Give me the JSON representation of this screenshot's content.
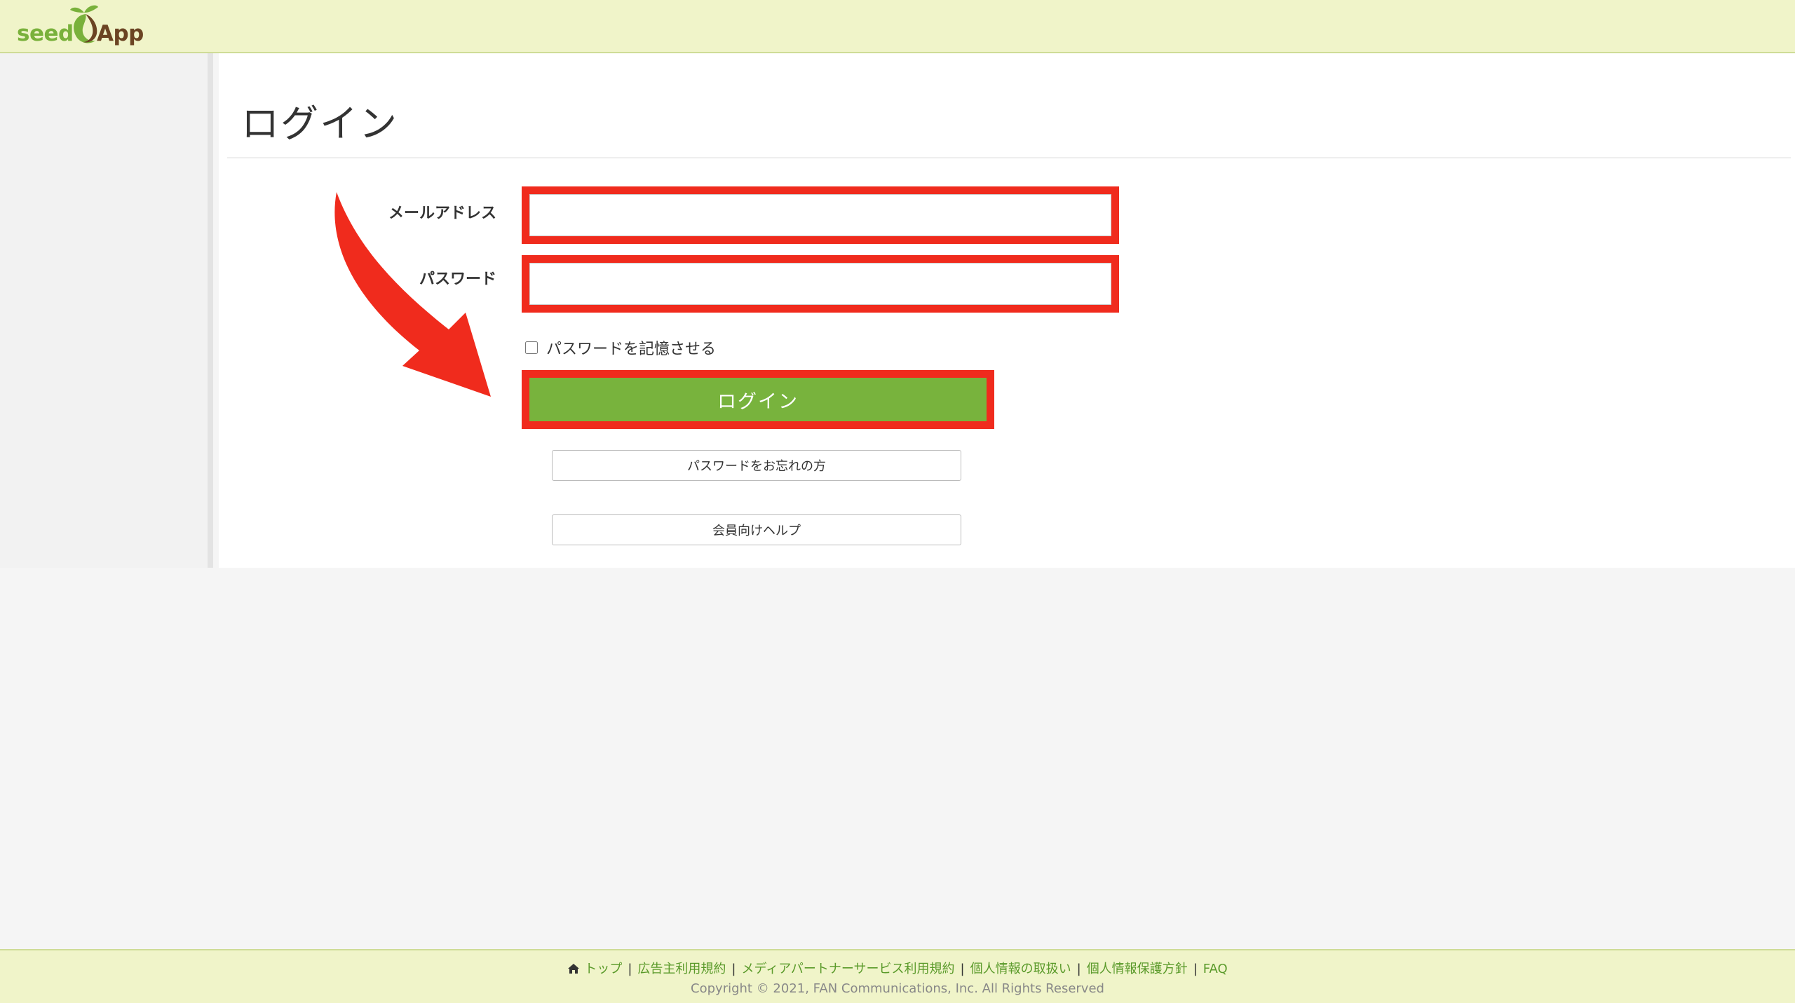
{
  "header": {
    "logo_left": "seed",
    "logo_right": "App"
  },
  "main": {
    "title": "ログイン",
    "form": {
      "email_label": "メールアドレス",
      "email_value": "",
      "password_label": "パスワード",
      "password_value": "",
      "remember_label": "パスワードを記憶させる",
      "login_button": "ログイン",
      "forgot_button": "パスワードをお忘れの方",
      "help_button": "会員向けヘルプ"
    }
  },
  "footer": {
    "links": [
      {
        "label": "トップ"
      },
      {
        "label": "広告主利用規約"
      },
      {
        "label": "メディアパートナーサービス利用規約"
      },
      {
        "label": "個人情報の取扱い"
      },
      {
        "label": "個人情報保護方針"
      },
      {
        "label": "FAQ"
      }
    ],
    "copyright": "Copyright © 2021, FAN Communications, Inc. All Rights Reserved"
  },
  "colors": {
    "header_bg": "#f0f4c9",
    "accent_green": "#78b33d",
    "annotation_red": "#f02b1d",
    "logo_brown": "#6b4423"
  },
  "icons": {
    "home": "home-icon",
    "logo": "seed-sprout-icon",
    "annotation": "red-arrow-icon"
  }
}
